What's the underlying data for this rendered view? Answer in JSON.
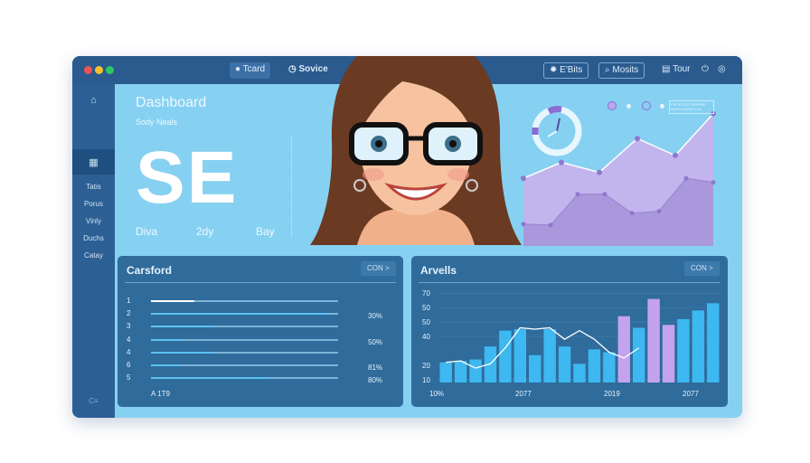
{
  "header": {
    "buttons": [
      {
        "label": "Tcard",
        "icon": "circle-icon"
      },
      {
        "label": "Sovice",
        "icon": "clock-icon"
      },
      {
        "label": "E'Bits",
        "icon": "gear-icon"
      },
      {
        "label": "Mosits",
        "icon": "search-icon"
      },
      {
        "label": "Tour",
        "icon": "document-icon"
      }
    ],
    "icons": [
      "power-icon",
      "settings-icon"
    ],
    "traffic_colors": [
      "#ef5350",
      "#f5c02c",
      "#2ec760"
    ]
  },
  "sidebar": {
    "items": [
      {
        "label": "Tatis"
      },
      {
        "label": "Porus"
      },
      {
        "label": "Vinly"
      },
      {
        "label": "Duchs"
      },
      {
        "label": "Catay"
      }
    ],
    "footer": "C≡"
  },
  "hero": {
    "title": "Dashboard",
    "subtitle": "Sody Neals",
    "big": "SE",
    "labels": [
      "Diva",
      "2dy",
      "Bay"
    ]
  },
  "legend": {
    "text": "PSI SDSOT SUPRSE\nNUPS NUNG S NL"
  },
  "card1": {
    "title": "Carsford",
    "button": "CON >",
    "rows": [
      {
        "n": "1",
        "fill": 0.23,
        "pct": ""
      },
      {
        "n": "2",
        "fill": 0.94,
        "pct": "30%"
      },
      {
        "n": "3",
        "fill": 0.33,
        "pct": ""
      },
      {
        "n": "4",
        "fill": 0.16,
        "pct": "50%"
      },
      {
        "n": "4",
        "fill": 0.33,
        "pct": ""
      },
      {
        "n": "6",
        "fill": 0.15,
        "pct": "81%"
      },
      {
        "n": "5",
        "fill": 0.63,
        "pct": "80%"
      }
    ],
    "footer": "A 1T9"
  },
  "card2": {
    "title": "Arvells",
    "button": "CON >"
  },
  "chart_data": [
    {
      "type": "area",
      "series": [
        {
          "values": [
            68,
            84,
            74,
            108,
            91,
            133
          ]
        },
        {
          "values": [
            22,
            21,
            52,
            52,
            33,
            35,
            68,
            64
          ]
        }
      ],
      "colors": [
        "#c2b5ee",
        "#a998dc"
      ]
    },
    {
      "type": "bar",
      "ylim": [
        8,
        72
      ],
      "yticks": [
        "70",
        "50",
        "50",
        "40",
        "20",
        "10"
      ],
      "xticks": [
        "10%",
        "2077",
        "2019",
        "2077"
      ],
      "values": [
        22,
        23,
        24,
        33,
        44,
        45,
        27,
        45,
        33,
        21,
        31,
        29,
        54,
        46,
        66,
        48,
        52,
        58,
        63
      ],
      "highlight": [
        12,
        14,
        15
      ],
      "colors": {
        "bar": "#3db8f0",
        "highlight": "#c4a3ee",
        "line": "#ffffff"
      },
      "line": [
        22,
        23,
        18,
        21,
        32,
        46,
        45,
        46,
        38,
        44,
        38,
        29,
        25,
        32
      ]
    }
  ]
}
